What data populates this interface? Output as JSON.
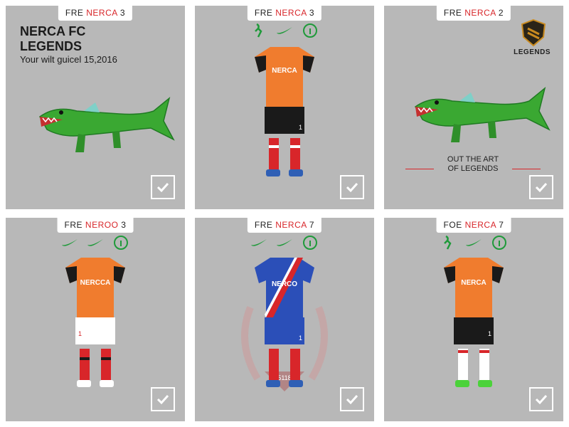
{
  "cards": [
    {
      "tag_prefix": "FRE",
      "tag_name": "NERCA",
      "tag_number": "3",
      "title_line1": "NERCA FC",
      "title_line2": "LEGENDS",
      "subtitle": "Your wilt guicel 15,2016",
      "image": "green-crocodile",
      "selected": true
    },
    {
      "tag_prefix": "FRE",
      "tag_name": "NERCA",
      "tag_number": "3",
      "icons": [
        "runner-icon",
        "swoosh-icon",
        "info-icon"
      ],
      "kit_text": "NERCA",
      "kit_shirt_color": "#f07c2e",
      "kit_shorts_color": "#1a1a1a",
      "kit_socks_color": "#d8262a",
      "kit_boots_color": "#2f5fb5",
      "short_number": "1",
      "selected": true
    },
    {
      "tag_prefix": "FRE",
      "tag_name": "NERCA",
      "tag_number": "2",
      "crest_label": "LEGENDS",
      "caption_line1": "OUT THE ART",
      "caption_line2": "OF LEGENDS",
      "image": "green-crocodile",
      "selected": true
    },
    {
      "tag_prefix": "FRE",
      "tag_name": "NEROO",
      "tag_number": "3",
      "icons": [
        "swoosh-icon",
        "swoosh-icon",
        "info-icon"
      ],
      "kit_text": "NERCCA",
      "kit_shirt_color": "#f07c2e",
      "kit_shorts_color": "#ffffff",
      "kit_socks_color": "#d8262a",
      "kit_boots_color": "#ffffff",
      "short_number": "1",
      "selected": true
    },
    {
      "tag_prefix": "FRE",
      "tag_name": "NERCA",
      "tag_number": "7",
      "icons": [
        "swoosh-icon",
        "swoosh-icon",
        "info-icon"
      ],
      "kit_text": "NERCO",
      "kit_shirt_color": "#2b4fb8",
      "kit_shorts_color": "#2b4fb8",
      "kit_socks_color": "#d8262a",
      "kit_boots_color": "#2f5fb5",
      "badge_text": "5118",
      "short_number": "1",
      "selected": true
    },
    {
      "tag_prefix": "FOE",
      "tag_name": "NERCA",
      "tag_number": "7",
      "icons": [
        "runner-icon",
        "swoosh-icon",
        "info-icon"
      ],
      "kit_text": "NERCA",
      "kit_shirt_color": "#f07c2e",
      "kit_shorts_color": "#1a1a1a",
      "kit_socks_color": "#ffffff",
      "kit_boots_color": "#4bd23a",
      "short_number": "1",
      "selected": true
    }
  ],
  "colors": {
    "card_bg": "#b8b8b8",
    "accent_red": "#d8262a",
    "icon_green": "#1f9a3a"
  }
}
